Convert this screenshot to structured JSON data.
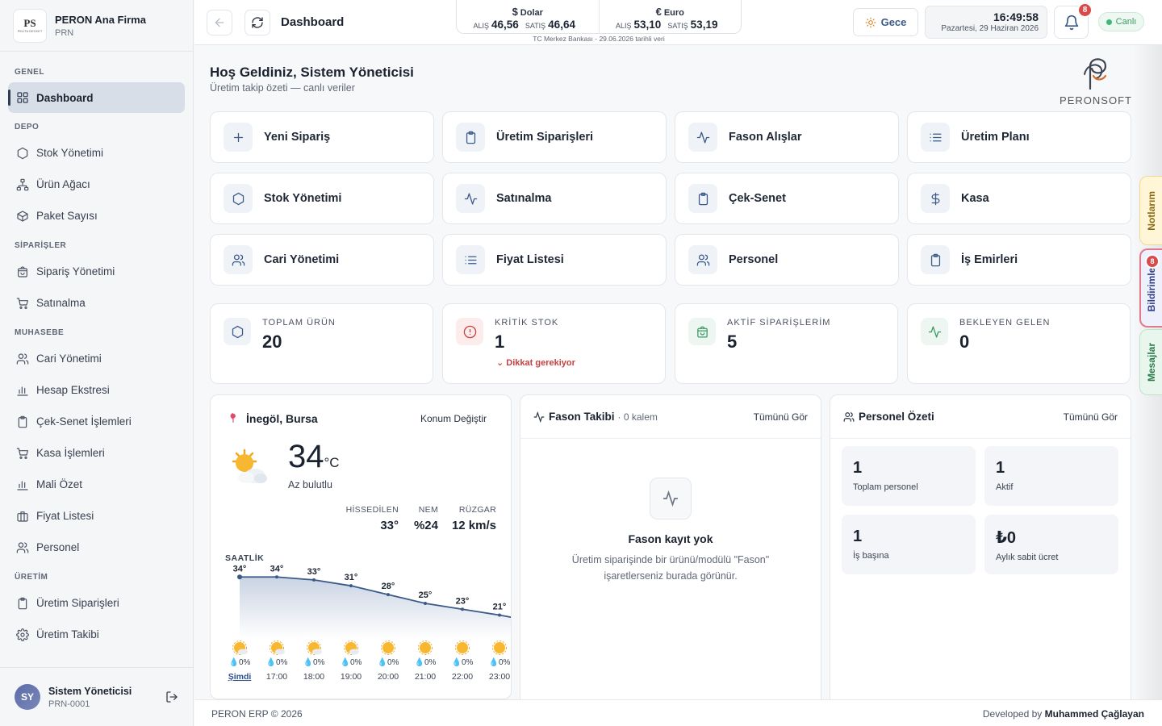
{
  "brand": {
    "title": "PERON Ana Firma",
    "code": "PRN",
    "logo_text": "PS",
    "logo_sub": "PELİTA DECKET"
  },
  "sidebar": {
    "sections": [
      {
        "label": "GENEL",
        "items": [
          {
            "label": "Dashboard",
            "icon": "grid-icon",
            "active": true
          }
        ]
      },
      {
        "label": "DEPO",
        "items": [
          {
            "label": "Stok Yönetimi",
            "icon": "hexagon-icon"
          },
          {
            "label": "Ürün Ağacı",
            "icon": "tree-icon"
          },
          {
            "label": "Paket Sayısı",
            "icon": "package-icon"
          }
        ]
      },
      {
        "label": "SİPARİŞLER",
        "items": [
          {
            "label": "Sipariş Yönetimi",
            "icon": "bag-icon"
          },
          {
            "label": "Satınalma",
            "icon": "cart-icon"
          }
        ]
      },
      {
        "label": "MUHASEBE",
        "items": [
          {
            "label": "Cari Yönetimi",
            "icon": "users-icon"
          },
          {
            "label": "Hesap Ekstresi",
            "icon": "bar-chart-icon"
          },
          {
            "label": "Çek-Senet İşlemleri",
            "icon": "clipboard-icon"
          },
          {
            "label": "Kasa İşlemleri",
            "icon": "cart-icon"
          },
          {
            "label": "Mali Özet",
            "icon": "bar-chart-icon"
          },
          {
            "label": "Fiyat Listesi",
            "icon": "briefcase-icon"
          },
          {
            "label": "Personel",
            "icon": "users-icon"
          }
        ]
      },
      {
        "label": "ÜRETİM",
        "items": [
          {
            "label": "Üretim Siparişleri",
            "icon": "clipboard-icon"
          },
          {
            "label": "Üretim Takibi",
            "icon": "gear-icon"
          }
        ]
      }
    ],
    "user": {
      "initials": "SY",
      "name": "Sistem Yöneticisi",
      "code": "PRN-0001"
    }
  },
  "header": {
    "title": "Dashboard",
    "fx": {
      "usd": {
        "symbol": "$",
        "name": "Dolar",
        "buy_label": "ALIŞ",
        "buy": "46,56",
        "sell_label": "SATIŞ",
        "sell": "46,64"
      },
      "eur": {
        "symbol": "€",
        "name": "Euro",
        "buy_label": "ALIŞ",
        "buy": "53,10",
        "sell_label": "SATIŞ",
        "sell": "53,19"
      },
      "note": "TC Merkez Bankası - 29.06.2026 tarihli veri"
    },
    "theme_label": "Gece",
    "time": "16:49:58",
    "date": "Pazartesi, 29 Haziran 2026",
    "notif_count": "8",
    "live_label": "Canlı"
  },
  "welcome": {
    "title": "Hoş Geldiniz, Sistem Yöneticisi",
    "subtitle": "Üretim takip özeti — canlı veriler"
  },
  "peron_logo": {
    "a": "PERON",
    "b": "SOFT"
  },
  "quick_actions": [
    {
      "label": "Yeni Sipariş",
      "icon": "plus-icon"
    },
    {
      "label": "Üretim Siparişleri",
      "icon": "clipboard-icon"
    },
    {
      "label": "Fason Alışlar",
      "icon": "activity-icon"
    },
    {
      "label": "Üretim Planı",
      "icon": "list-icon"
    },
    {
      "label": "Stok Yönetimi",
      "icon": "hexagon-icon"
    },
    {
      "label": "Satınalma",
      "icon": "activity-icon"
    },
    {
      "label": "Çek-Senet",
      "icon": "clipboard-icon"
    },
    {
      "label": "Kasa",
      "icon": "dollar-icon"
    },
    {
      "label": "Cari Yönetimi",
      "icon": "users-icon"
    },
    {
      "label": "Fiyat Listesi",
      "icon": "list-icon"
    },
    {
      "label": "Personel",
      "icon": "users-icon"
    },
    {
      "label": "İş Emirleri",
      "icon": "clipboard-icon"
    }
  ],
  "stats": [
    {
      "label": "TOPLAM ÜRÜN",
      "value": "20",
      "icon": "hexagon-icon"
    },
    {
      "label": "KRİTİK STOK",
      "value": "1",
      "warning": "Dikkat gerekiyor",
      "icon": "alert-icon"
    },
    {
      "label": "AKTİF SİPARİŞLERİM",
      "value": "5",
      "icon": "bag-icon"
    },
    {
      "label": "BEKLEYEN GELEN",
      "value": "0",
      "icon": "activity-icon"
    }
  ],
  "weather": {
    "location": "İnegöl, Bursa",
    "change_label": "Konum Değiştir",
    "temp": "34",
    "unit": "°C",
    "condition": "Az bulutlu",
    "details": [
      {
        "label": "HİSSEDİLEN",
        "value": "33°"
      },
      {
        "label": "NEM",
        "value": "%24"
      },
      {
        "label": "RÜZGAR",
        "value": "12 km/s"
      }
    ],
    "hourly_label": "SAATLİK",
    "hourly": [
      {
        "time": "Şimdi",
        "temp": "34°",
        "rain": "0%",
        "icon": "partly-cloudy"
      },
      {
        "time": "17:00",
        "temp": "34°",
        "rain": "0%",
        "icon": "partly-cloudy"
      },
      {
        "time": "18:00",
        "temp": "33°",
        "rain": "0%",
        "icon": "partly-cloudy"
      },
      {
        "time": "19:00",
        "temp": "31°",
        "rain": "0%",
        "icon": "partly-cloudy"
      },
      {
        "time": "20:00",
        "temp": "28°",
        "rain": "0%",
        "icon": "sun"
      },
      {
        "time": "21:00",
        "temp": "25°",
        "rain": "0%",
        "icon": "sun"
      },
      {
        "time": "22:00",
        "temp": "23°",
        "rain": "0%",
        "icon": "sun"
      },
      {
        "time": "23:00",
        "temp": "21°",
        "rain": "0%",
        "icon": "sun"
      }
    ]
  },
  "fason": {
    "title": "Fason Takibi",
    "count": "· 0 kalem",
    "link": "Tümünü Gör",
    "empty_title": "Fason kayıt yok",
    "empty_text": "Üretim siparişinde bir ürünü/modülü \"Fason\" işaretlerseniz burada görünür."
  },
  "personel": {
    "title": "Personel Özeti",
    "link": "Tümünü Gör",
    "stats": [
      {
        "value": "1",
        "label": "Toplam personel"
      },
      {
        "value": "1",
        "label": "Aktif"
      },
      {
        "value": "1",
        "label": "İş başına"
      },
      {
        "value": "₺0",
        "label": "Aylık sabit ücret"
      }
    ]
  },
  "side_tabs": {
    "notes": "Notlarım",
    "notifications": "Bildirimler",
    "notifications_count": "8",
    "messages": "Mesajlar"
  },
  "footer": {
    "left": "PERON ERP © 2026",
    "right_prefix": "Developed by",
    "right_name": "Muhammed Çağlayan"
  }
}
